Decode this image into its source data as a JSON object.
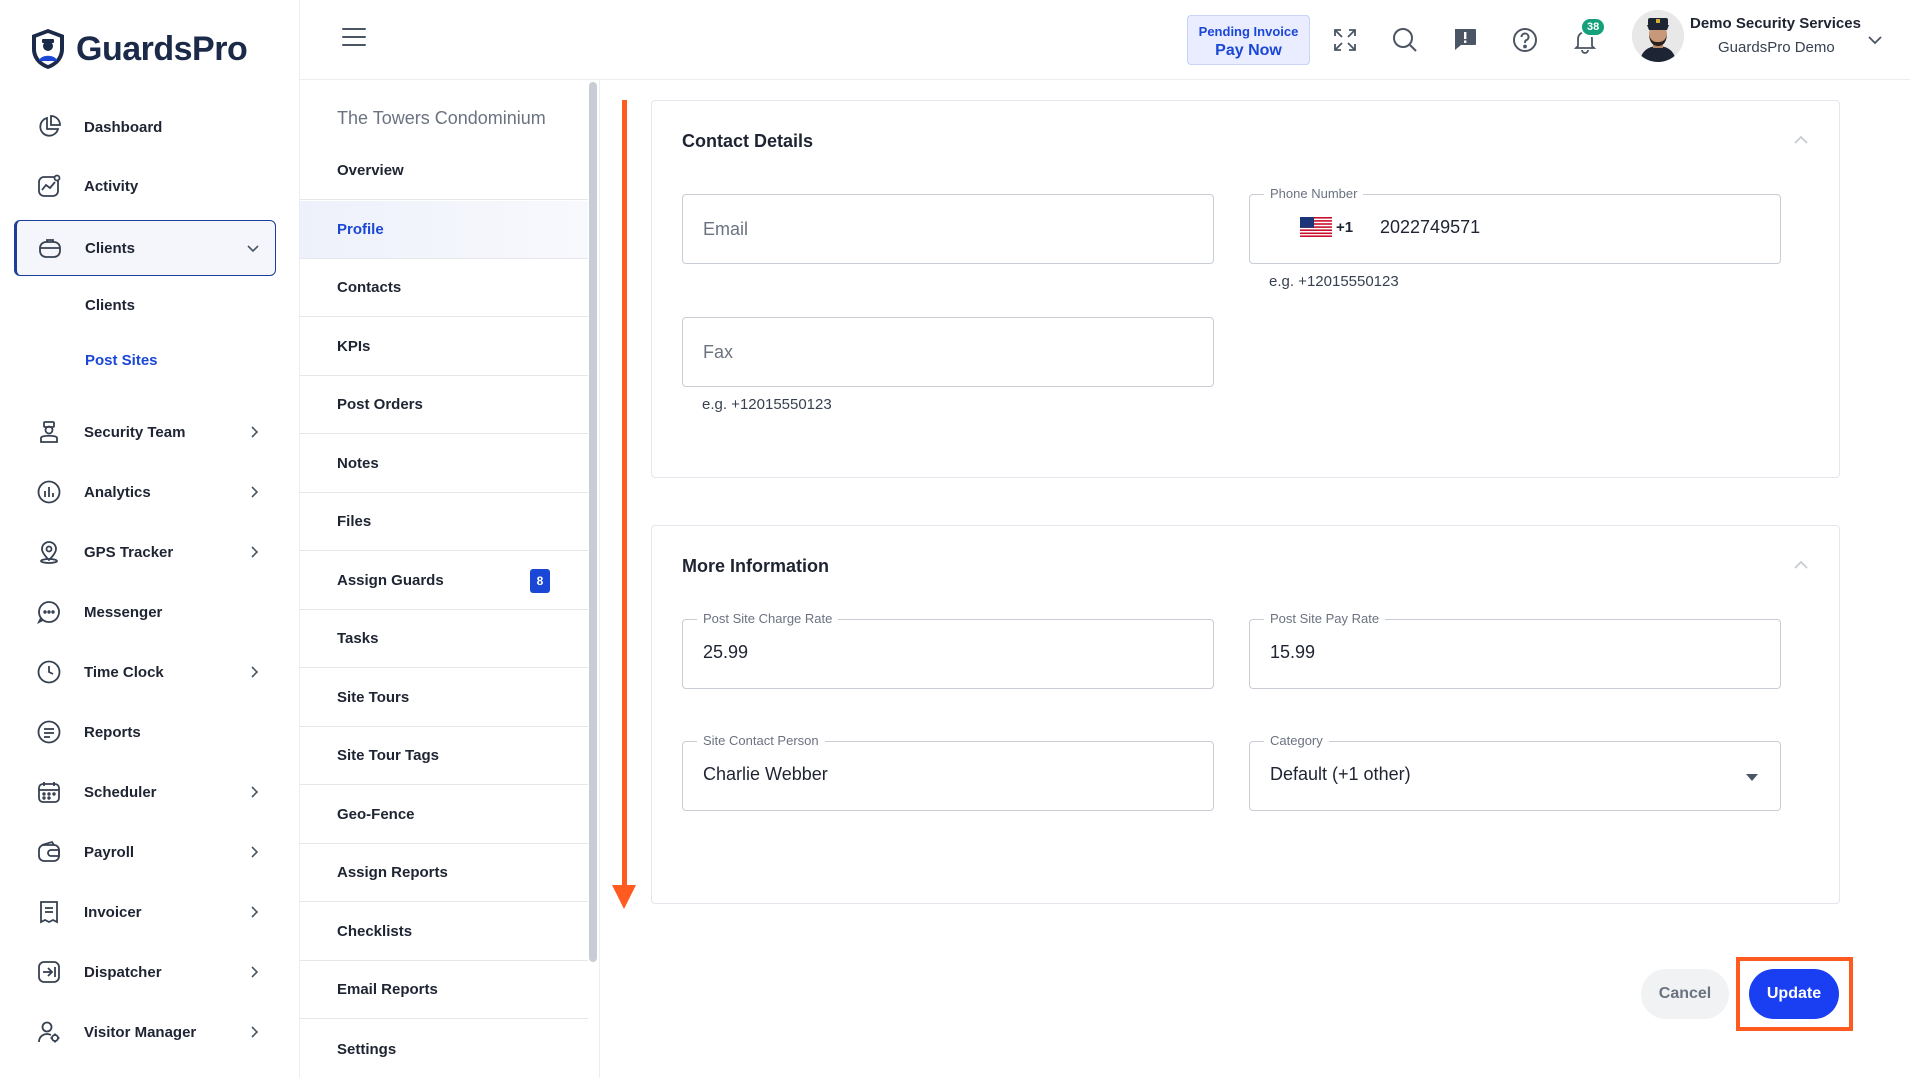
{
  "app": {
    "name": "GuardsPro"
  },
  "sidebar": {
    "items": [
      {
        "label": "Dashboard",
        "icon": "dashboard-icon"
      },
      {
        "label": "Activity",
        "icon": "activity-icon"
      },
      {
        "label": "Clients",
        "icon": "clients-icon",
        "expanded": true
      },
      {
        "label": "Security Team",
        "icon": "security-team-icon"
      },
      {
        "label": "Analytics",
        "icon": "analytics-icon"
      },
      {
        "label": "GPS Tracker",
        "icon": "gps-icon"
      },
      {
        "label": "Messenger",
        "icon": "messenger-icon"
      },
      {
        "label": "Time Clock",
        "icon": "clock-icon"
      },
      {
        "label": "Reports",
        "icon": "reports-icon"
      },
      {
        "label": "Scheduler",
        "icon": "calendar-icon"
      },
      {
        "label": "Payroll",
        "icon": "wallet-icon"
      },
      {
        "label": "Invoicer",
        "icon": "invoice-icon"
      },
      {
        "label": "Dispatcher",
        "icon": "dispatcher-icon"
      },
      {
        "label": "Visitor Manager",
        "icon": "visitor-icon"
      }
    ],
    "clients_sub": [
      {
        "label": "Clients"
      },
      {
        "label": "Post Sites",
        "current": true
      }
    ]
  },
  "header": {
    "pending_invoice": "Pending Invoice",
    "pay_now": "Pay Now",
    "notification_count": "38",
    "user_name": "Demo Security Services",
    "user_company": "GuardsPro Demo"
  },
  "subnav": {
    "title": "The Towers Condominium",
    "items": [
      {
        "label": "Overview"
      },
      {
        "label": "Profile",
        "current": true
      },
      {
        "label": "Contacts"
      },
      {
        "label": "KPIs"
      },
      {
        "label": "Post Orders"
      },
      {
        "label": "Notes"
      },
      {
        "label": "Files"
      },
      {
        "label": "Assign Guards",
        "count": "8"
      },
      {
        "label": "Tasks"
      },
      {
        "label": "Site Tours"
      },
      {
        "label": "Site Tour Tags"
      },
      {
        "label": "Geo-Fence"
      },
      {
        "label": "Assign Reports"
      },
      {
        "label": "Checklists"
      },
      {
        "label": "Email Reports"
      },
      {
        "label": "Settings"
      }
    ]
  },
  "contact": {
    "title": "Contact Details",
    "email_placeholder": "Email",
    "phone_label": "Phone Number",
    "phone_code": "+1",
    "phone_value": "2022749571",
    "phone_hint": "e.g. +12015550123",
    "fax_placeholder": "Fax",
    "fax_hint": "e.g. +12015550123"
  },
  "more_info": {
    "title": "More Information",
    "charge_rate_label": "Post Site Charge Rate",
    "charge_rate_value": "25.99",
    "pay_rate_label": "Post Site Pay Rate",
    "pay_rate_value": "15.99",
    "contact_person_label": "Site Contact Person",
    "contact_person_value": "Charlie Webber",
    "category_label": "Category",
    "category_value": "Default (+1 other)"
  },
  "actions": {
    "cancel": "Cancel",
    "update": "Update"
  },
  "colors": {
    "primary": "#1a3ff2",
    "accent": "#1a47d6",
    "annotation": "#ff5a1f",
    "badge": "#14a07a"
  }
}
